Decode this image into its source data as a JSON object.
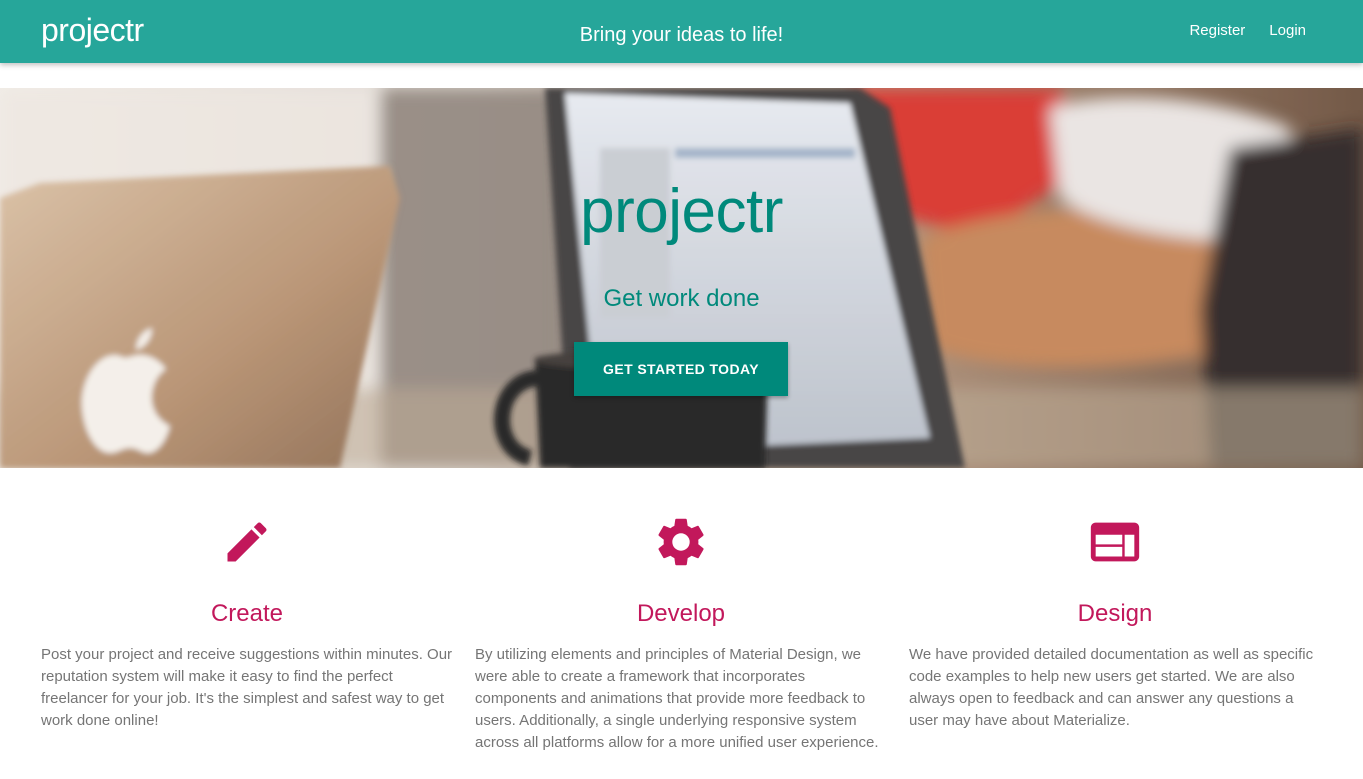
{
  "navbar": {
    "brand": "projectr",
    "tagline": "Bring your ideas to life!",
    "links": [
      {
        "label": "Register"
      },
      {
        "label": "Login"
      }
    ]
  },
  "hero": {
    "title": "projectr",
    "subtitle": "Get work done",
    "cta_label": "GET STARTED TODAY"
  },
  "features": [
    {
      "icon": "pencil-icon",
      "title": "Create",
      "description": "Post your project and receive suggestions within minutes. Our reputation system will make it easy to find the perfect freelancer for your job. It's the simplest and safest way to get work done online!"
    },
    {
      "icon": "gear-icon",
      "title": "Develop",
      "description": "By utilizing elements and principles of Material Design, we were able to create a framework that incorporates components and animations that provide more feedback to users. Additionally, a single underlying responsive system across all platforms allow for a more unified user experience."
    },
    {
      "icon": "web-layout-icon",
      "title": "Design",
      "description": "We have provided detailed documentation as well as specific code examples to help new users get started. We are also always open to feedback and can answer any questions a user may have about Materialize."
    }
  ],
  "colors": {
    "primary": "#26a69a",
    "primary_dark": "#00897b",
    "accent": "#c2185b",
    "body_text": "#757575"
  }
}
